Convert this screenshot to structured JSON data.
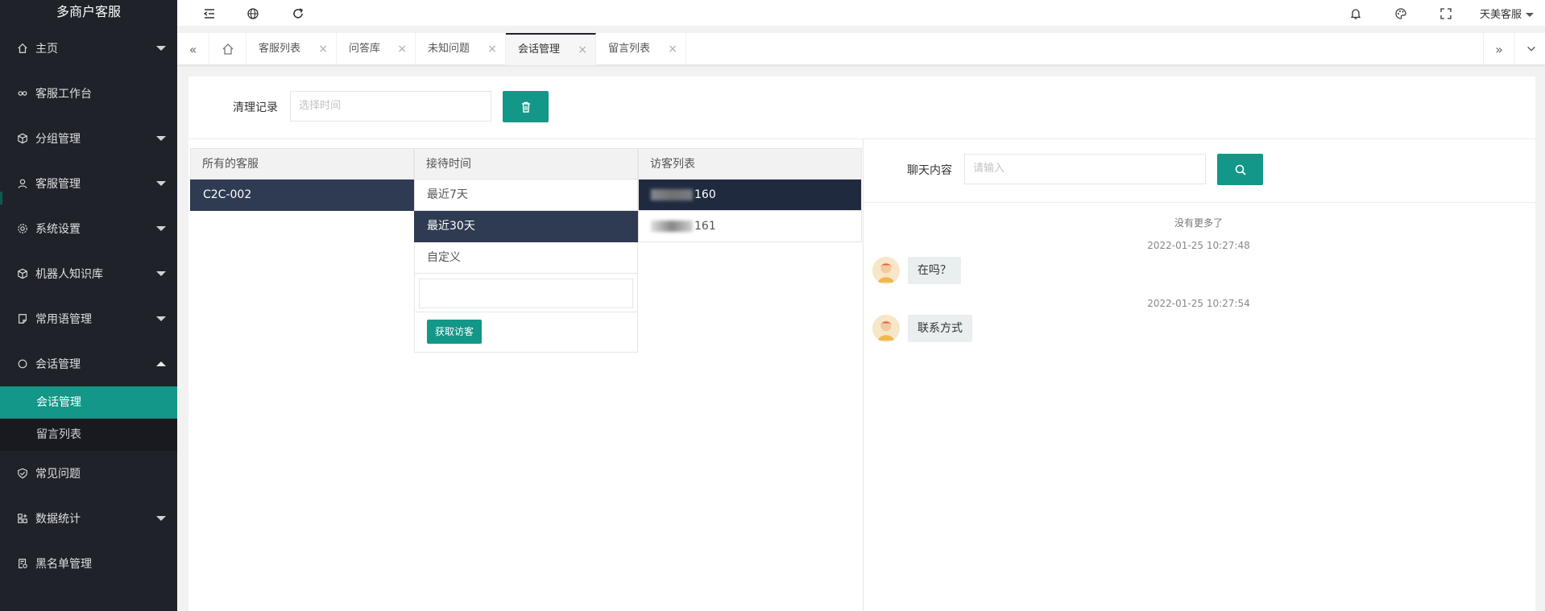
{
  "app": {
    "title": "多商户客服"
  },
  "sidebar": {
    "items": [
      {
        "label": "主页",
        "icon": "home-icon",
        "has_arrow": true
      },
      {
        "label": "客服工作台",
        "icon": "link-icon",
        "has_arrow": false
      },
      {
        "label": "分组管理",
        "icon": "cube-icon",
        "has_arrow": true
      },
      {
        "label": "客服管理",
        "icon": "user-icon",
        "has_arrow": true
      },
      {
        "label": "系统设置",
        "icon": "gear-icon",
        "has_arrow": true
      },
      {
        "label": "机器人知识库",
        "icon": "cube-icon",
        "has_arrow": true
      },
      {
        "label": "常用语管理",
        "icon": "note-icon",
        "has_arrow": true
      },
      {
        "label": "会话管理",
        "icon": "chat-icon",
        "has_arrow": true,
        "expanded": true
      }
    ],
    "sub_items": [
      {
        "label": "会话管理",
        "active": true
      },
      {
        "label": "留言列表",
        "active": false
      }
    ],
    "items_after": [
      {
        "label": "常见问题",
        "icon": "shield-icon",
        "has_arrow": false
      },
      {
        "label": "数据统计",
        "icon": "chart-icon",
        "has_arrow": true
      },
      {
        "label": "黑名单管理",
        "icon": "blacklist-icon",
        "has_arrow": false
      }
    ]
  },
  "header": {
    "user_label": "天美客服"
  },
  "tabs": [
    {
      "label": "客服列表"
    },
    {
      "label": "问答库"
    },
    {
      "label": "未知问题"
    },
    {
      "label": "会话管理",
      "active": true
    },
    {
      "label": "留言列表"
    }
  ],
  "toolbar": {
    "clear_label": "清理记录",
    "time_placeholder": "选择时间"
  },
  "columns": {
    "agents_header": "所有的客服",
    "agents": [
      "C2C-002"
    ],
    "time_header": "接待时间",
    "time_options": [
      "最近7天",
      "最近30天",
      "自定义"
    ],
    "time_selected": "最近30天",
    "fetch_label": "获取访客",
    "visitors_header": "访客列表",
    "visitors": [
      "160",
      "161"
    ]
  },
  "chat": {
    "search_label": "聊天内容",
    "search_placeholder": "请输入",
    "no_more": "没有更多了",
    "messages": [
      {
        "time": "2022-01-25 10:27:48",
        "text": "在吗？"
      },
      {
        "time": "2022-01-25 10:27:54",
        "text": "联系方式"
      }
    ]
  },
  "colors": {
    "accent": "#129788",
    "sidebar_bg": "#20222a",
    "selected_row": "#2f3b52"
  }
}
